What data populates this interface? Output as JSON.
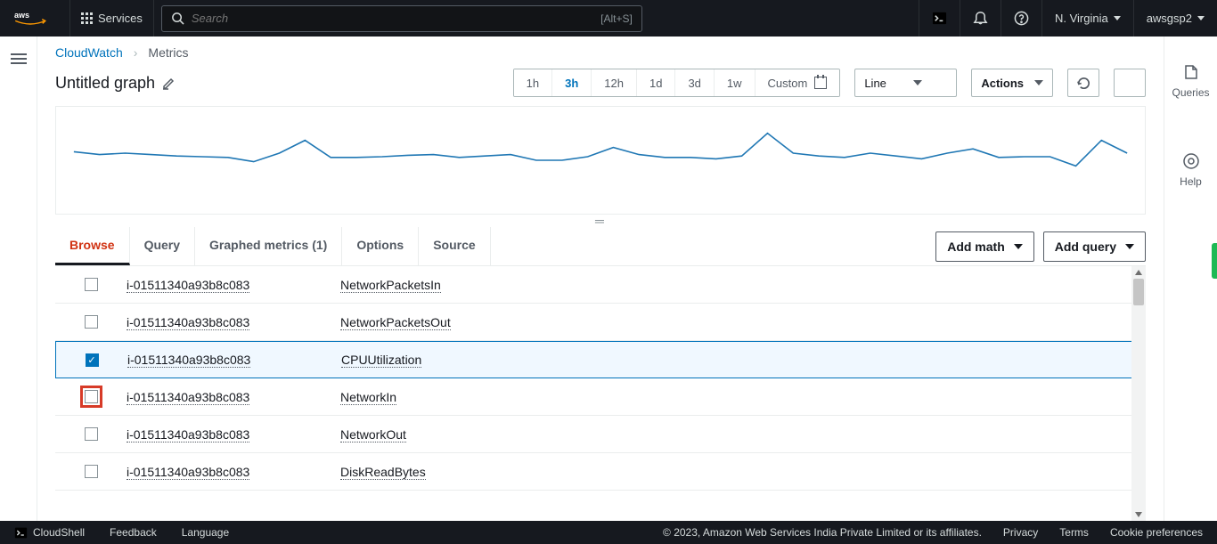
{
  "topnav": {
    "services_label": "Services",
    "search_placeholder": "Search",
    "search_shortcut": "[Alt+S]",
    "region": "N. Virginia",
    "account": "awsgsp2"
  },
  "breadcrumb": {
    "root": "CloudWatch",
    "current": "Metrics"
  },
  "graph": {
    "title": "Untitled graph"
  },
  "time_ranges": [
    "1h",
    "3h",
    "12h",
    "1d",
    "3d",
    "1w"
  ],
  "time_range_active": "3h",
  "custom_label": "Custom",
  "chart_type": "Line",
  "actions_label": "Actions",
  "tabs": {
    "browse": "Browse",
    "query": "Query",
    "graphed": "Graphed metrics (1)",
    "options": "Options",
    "source": "Source"
  },
  "buttons": {
    "add_math": "Add math",
    "add_query": "Add query"
  },
  "metrics": [
    {
      "instance": "i-01511340a93b8c083",
      "name": "NetworkPacketsIn",
      "checked": false,
      "highlight": false
    },
    {
      "instance": "i-01511340a93b8c083",
      "name": "NetworkPacketsOut",
      "checked": false,
      "highlight": false
    },
    {
      "instance": "i-01511340a93b8c083",
      "name": "CPUUtilization",
      "checked": true,
      "highlight": false
    },
    {
      "instance": "i-01511340a93b8c083",
      "name": "NetworkIn",
      "checked": false,
      "highlight": true
    },
    {
      "instance": "i-01511340a93b8c083",
      "name": "NetworkOut",
      "checked": false,
      "highlight": false
    },
    {
      "instance": "i-01511340a93b8c083",
      "name": "DiskReadBytes",
      "checked": false,
      "highlight": false
    }
  ],
  "right_rail": {
    "queries": "Queries",
    "help": "Help"
  },
  "footer": {
    "cloudshell": "CloudShell",
    "feedback": "Feedback",
    "language": "Language",
    "copyright": "© 2023, Amazon Web Services India Private Limited or its affiliates.",
    "privacy": "Privacy",
    "terms": "Terms",
    "cookie": "Cookie preferences"
  },
  "chart_data": {
    "type": "line",
    "title": "",
    "series": [
      {
        "name": "CPUUtilization",
        "color": "#1f77b4",
        "values": [
          62,
          58,
          60,
          58,
          56,
          55,
          54,
          48,
          60,
          78,
          54,
          54,
          55,
          57,
          58,
          54,
          56,
          58,
          50,
          50,
          55,
          68,
          58,
          54,
          54,
          52,
          56,
          88,
          60,
          56,
          54,
          60,
          56,
          52,
          60,
          66,
          54,
          55,
          55,
          42,
          78,
          60
        ]
      }
    ],
    "x": {
      "ticks": 42
    },
    "ylim": [
      0,
      100
    ]
  }
}
